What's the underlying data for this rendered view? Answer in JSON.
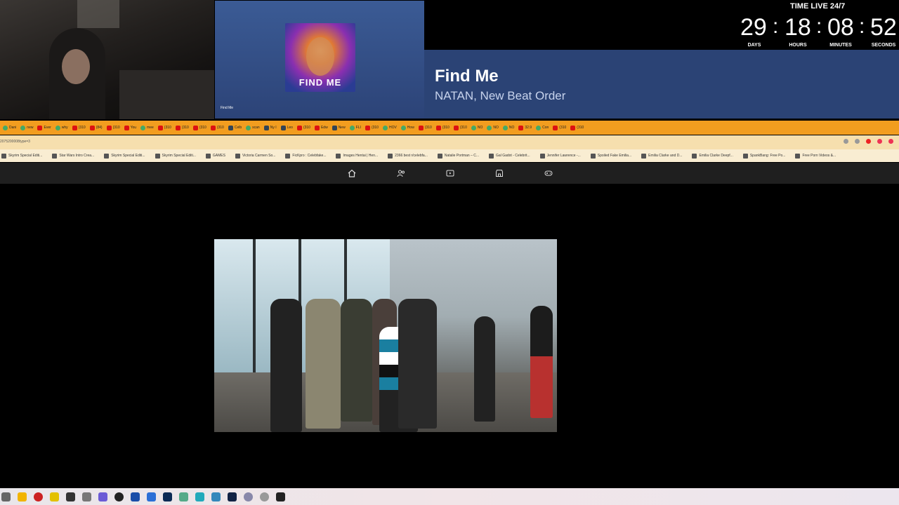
{
  "music": {
    "album_text": "FIND ME",
    "mini_title": "Find Me",
    "title": "Find Me",
    "artist": "NATAN, New Beat Order"
  },
  "timer": {
    "label": "TIME LIVE 24/7",
    "days": "29",
    "hours": "18",
    "minutes": "08",
    "seconds": "52",
    "days_label": "DAYS",
    "hours_label": "HOURS",
    "minutes_label": "MINUTES",
    "seconds_label": "SECONDS"
  },
  "tabs": [
    {
      "label": "Dani",
      "icon": "g"
    },
    {
      "label": "new",
      "icon": "g"
    },
    {
      "label": "Ever",
      "icon": "r"
    },
    {
      "label": "why",
      "icon": "g"
    },
    {
      "label": "(310",
      "icon": "r"
    },
    {
      "label": "(84)",
      "icon": "r"
    },
    {
      "label": "(310",
      "icon": "r"
    },
    {
      "label": "You",
      "icon": "r"
    },
    {
      "label": "mee",
      "icon": "g"
    },
    {
      "label": "(310",
      "icon": "r"
    },
    {
      "label": "(310",
      "icon": "r"
    },
    {
      "label": "(310",
      "icon": "r"
    },
    {
      "label": "(310",
      "icon": "r"
    },
    {
      "label": "Celb",
      "icon": "b"
    },
    {
      "label": "scan",
      "icon": "g"
    },
    {
      "label": "Ny I",
      "icon": "b"
    },
    {
      "label": "Leo",
      "icon": "b"
    },
    {
      "label": "(310",
      "icon": "r"
    },
    {
      "label": "Edw",
      "icon": "r"
    },
    {
      "label": "New",
      "icon": "b"
    },
    {
      "label": "FLI",
      "icon": "g"
    },
    {
      "label": "(310",
      "icon": "r"
    },
    {
      "label": "HOV",
      "icon": "g"
    },
    {
      "label": "How",
      "icon": "g"
    },
    {
      "label": "(310",
      "icon": "r"
    },
    {
      "label": "(310",
      "icon": "r"
    },
    {
      "label": "(310",
      "icon": "r"
    },
    {
      "label": "NO",
      "icon": "g"
    },
    {
      "label": "NO",
      "icon": "g"
    },
    {
      "label": "NO",
      "icon": "g"
    },
    {
      "label": "32.9",
      "icon": "r"
    },
    {
      "label": "Con",
      "icon": "g"
    },
    {
      "label": "(310",
      "icon": "r"
    },
    {
      "label": "(310",
      "icon": "r"
    }
  ],
  "address": "2075200008type=3",
  "bookmarks": [
    "Skyrim Special Editi...",
    "Star Wars Intro Crea...",
    "Skyrim Special Editi...",
    "Skyrim Special Editi...",
    "GAMES",
    "Victoria Carmen So...",
    "FicKpro : Celebfake...",
    "Images Hentai | Hen...",
    "2366 best r/celebfa...",
    "Natalie Portman – C...",
    "Gal Gadot - Celebrit...",
    "Jennifer Lawrence -...",
    "Spoiled Fake Emilia...",
    "Emilia Clarke and D...",
    "Emilia Clarke Deepf...",
    "SpankBang: Free Po...",
    "Free Porn Videos &..."
  ],
  "nav_icons": [
    "home-icon",
    "friends-icon",
    "video-icon",
    "marketplace-icon",
    "gaming-icon"
  ],
  "colors": {
    "music_panel": "#2b4375",
    "tab_strip": "#f29d1f",
    "address_bar": "#f6dfae",
    "bookmarks_bar": "#f9edd2",
    "site_nav": "#1f1f1f"
  }
}
